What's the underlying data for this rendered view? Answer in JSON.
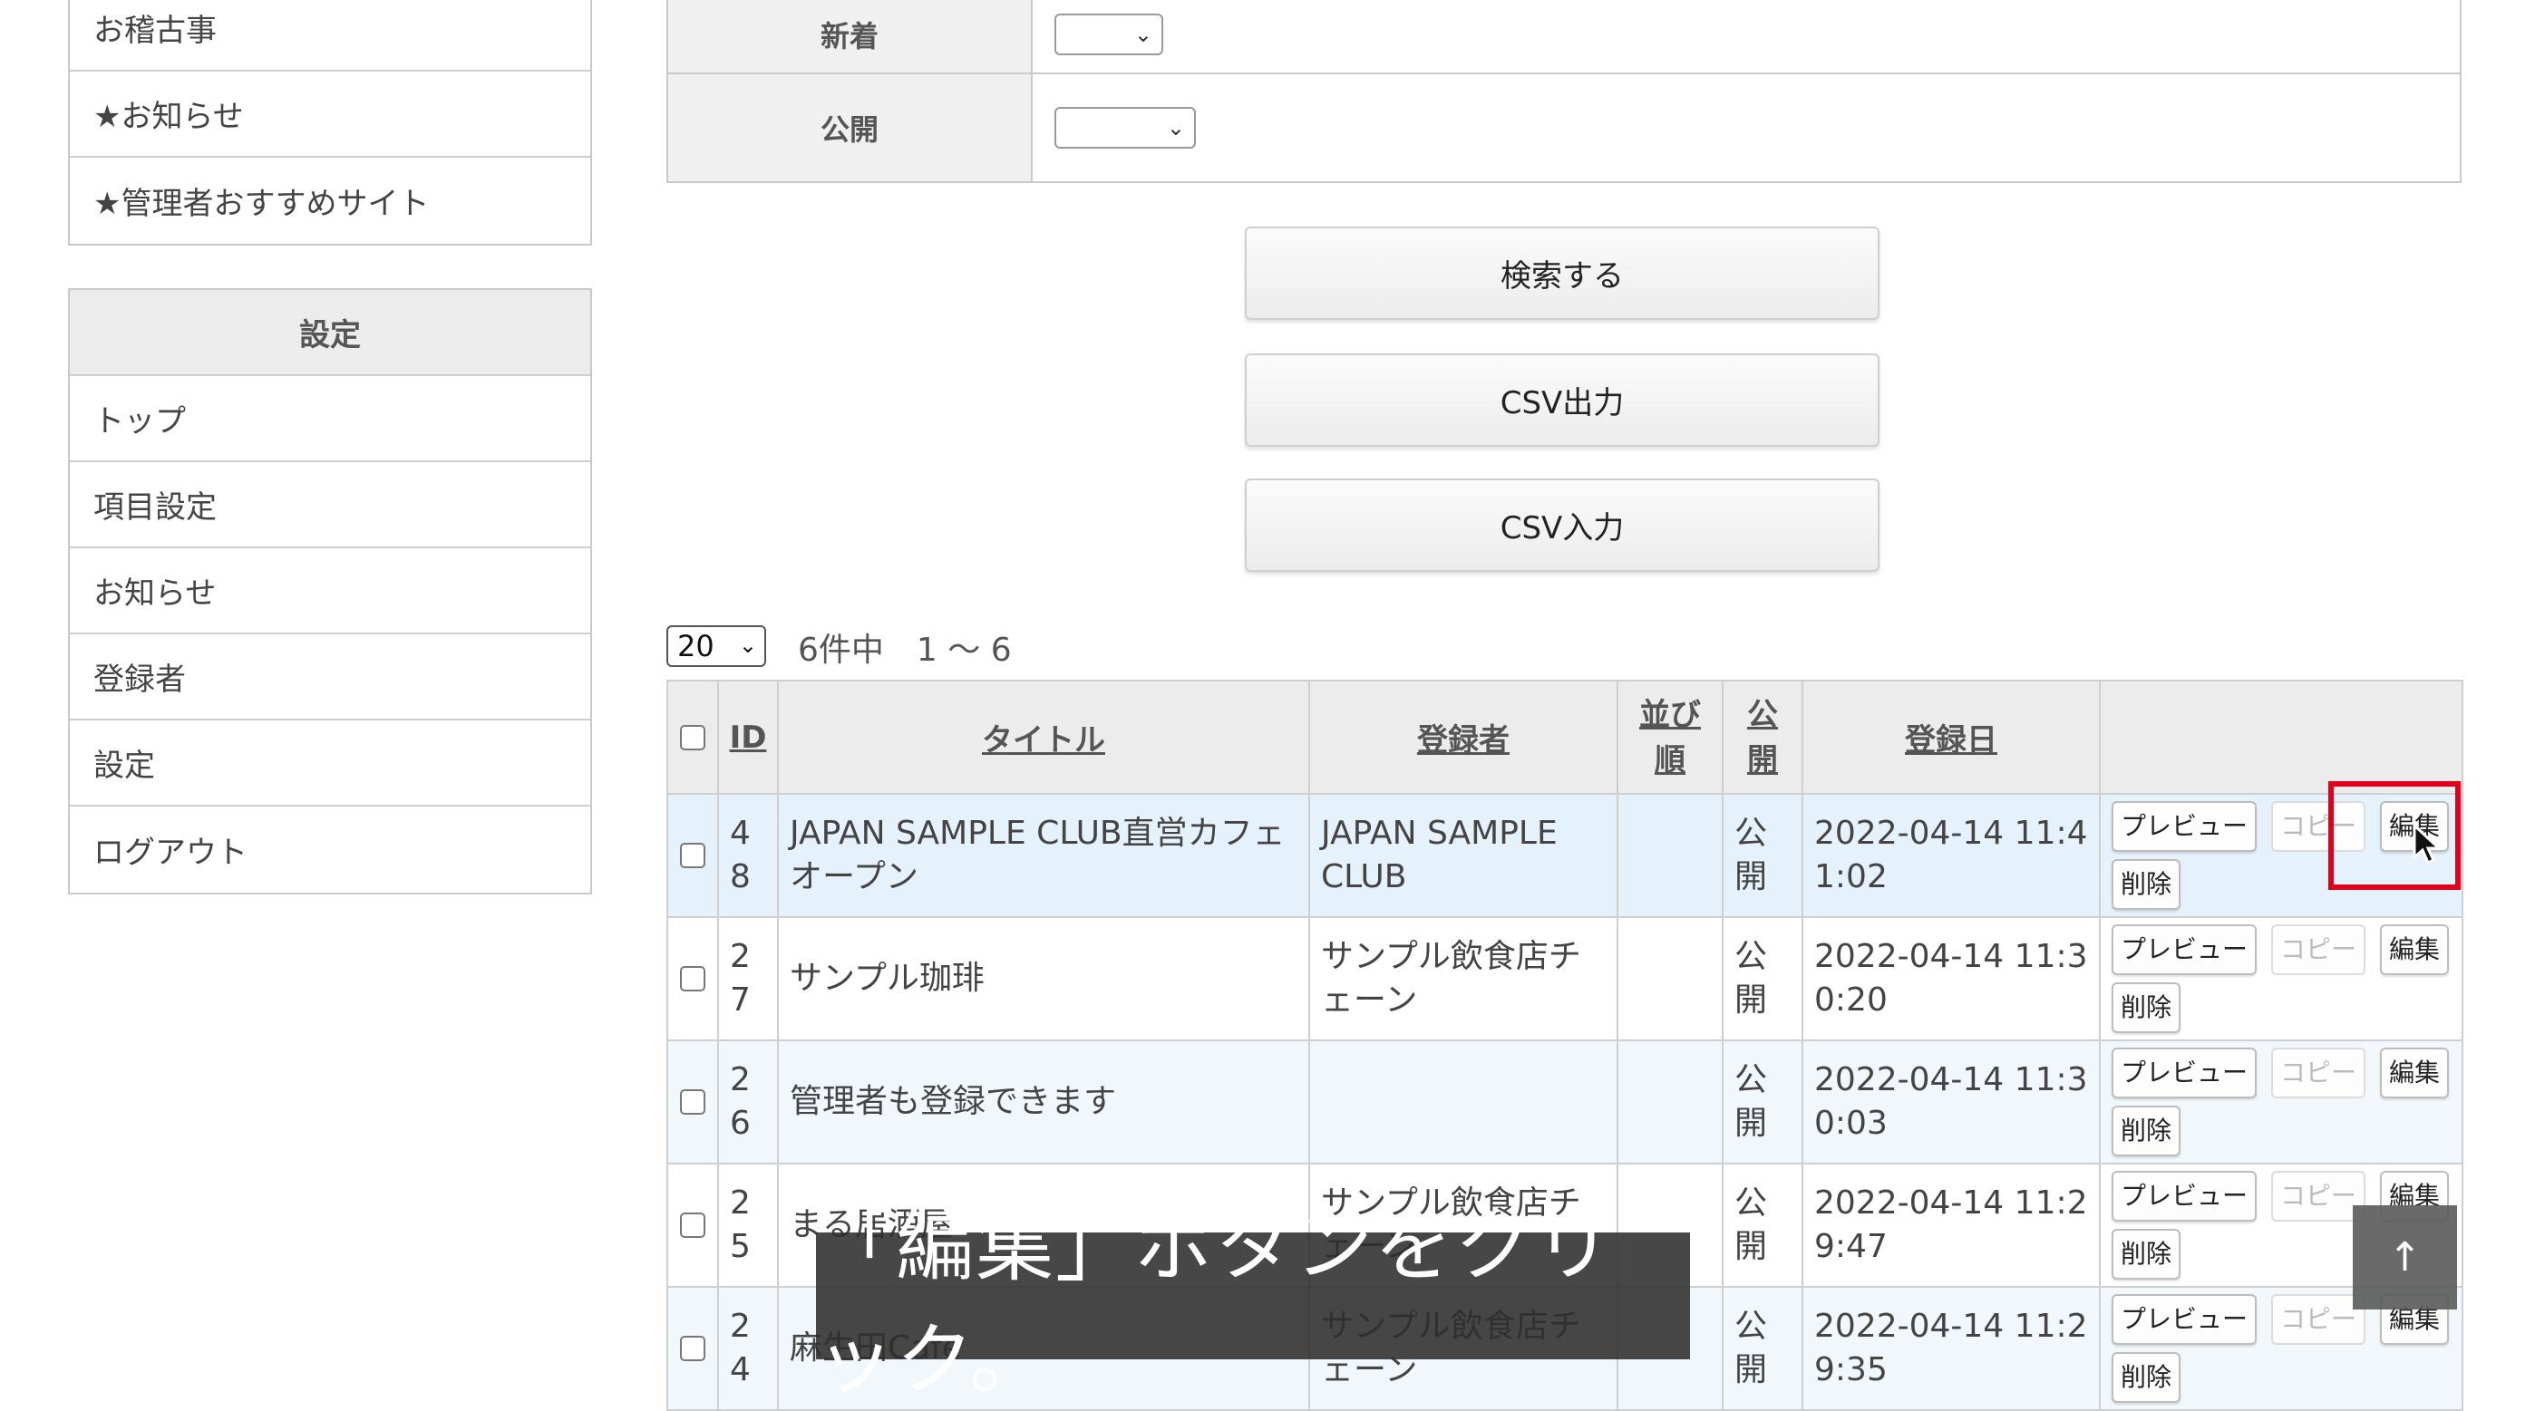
{
  "sidebar": {
    "group1": [
      "お稽古事",
      "★お知らせ",
      "★管理者おすすめサイト"
    ],
    "settings_header": "設定",
    "group2": [
      "トップ",
      "項目設定",
      "お知らせ",
      "登録者",
      "設定",
      "ログアウト"
    ]
  },
  "search_form": {
    "new_label": "新着",
    "public_label": "公開"
  },
  "buttons": {
    "search": "検索する",
    "csv_export": "CSV出力",
    "csv_import": "CSV入力"
  },
  "pagination": {
    "per_page": "20",
    "summary": "6件中　1 〜 6"
  },
  "table": {
    "headers": [
      "ID",
      "タイトル",
      "登録者",
      "並び順",
      "公開",
      "登録日"
    ],
    "action_labels": {
      "preview": "プレビュー",
      "copy": "コピー",
      "edit": "編集",
      "delete": "削除"
    },
    "rows": [
      {
        "id": "48",
        "title": "JAPAN SAMPLE CLUB直営カフェオープン",
        "registrant": "JAPAN SAMPLE CLUB",
        "order": "",
        "public": "公開",
        "date": "2022-04-14 11:41:02"
      },
      {
        "id": "27",
        "title": "サンプル珈琲",
        "registrant": "サンプル飲食店チェーン",
        "order": "",
        "public": "公開",
        "date": "2022-04-14 11:30:20"
      },
      {
        "id": "26",
        "title": "管理者も登録できます",
        "registrant": "",
        "order": "",
        "public": "公開",
        "date": "2022-04-14 11:30:03"
      },
      {
        "id": "25",
        "title": "まる居酒屋",
        "registrant": "サンプル飲食店チェーン",
        "order": "",
        "public": "公開",
        "date": "2022-04-14 11:29:47"
      },
      {
        "id": "24",
        "title": "麻生田Cafe",
        "registrant": "サンプル飲食店チェーン",
        "order": "",
        "public": "公開",
        "date": "2022-04-14 11:29:35"
      }
    ]
  },
  "caption": "「編集」ボタンをクリック。",
  "back_to_top": "↑",
  "colors": {
    "highlight": "#e0001b",
    "row_highlight": "#e6f2fb"
  }
}
